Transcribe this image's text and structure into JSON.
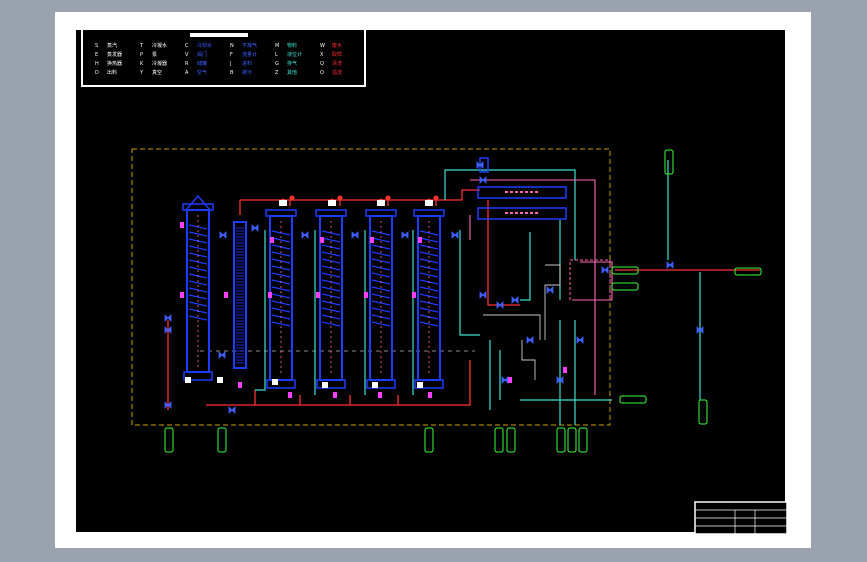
{
  "colors": {
    "background": "#9aa3ad",
    "frame": "#ffffff",
    "canvas": "#000000",
    "vessel": "#1e3cff",
    "steam": "#ff3030",
    "water": "#3ee0d0",
    "product": "#ff69b4",
    "boundary": "#c8a000",
    "label_box": "#39ff39"
  },
  "icons": {
    "corner_marks": "square-corner-mark",
    "columns": "evaporator-column",
    "valves": "valve-symbol",
    "pumps": "pump-symbol"
  },
  "legend": {
    "rows": [
      [
        "S",
        "蒸汽",
        "T",
        "冷凝水",
        "C",
        "冷却水",
        "N",
        "不凝气",
        "M",
        "物料",
        "W",
        "废水"
      ],
      [
        "E",
        "蒸发器",
        "P",
        "泵",
        "V",
        "阀门",
        "F",
        "流量计",
        "L",
        "液位计",
        "X",
        "取样"
      ],
      [
        "H",
        "换热器",
        "K",
        "冷凝器",
        "R",
        "储罐",
        "J",
        "进料",
        "G",
        "排气",
        "Q",
        "清洗"
      ],
      [
        "D",
        "出料",
        "Y",
        "真空",
        "A",
        "空气",
        "B",
        "排污",
        "Z",
        "其他",
        "O",
        "溢流"
      ]
    ]
  },
  "title_block": {
    "rows": [
      "",
      "",
      "",
      ""
    ]
  }
}
